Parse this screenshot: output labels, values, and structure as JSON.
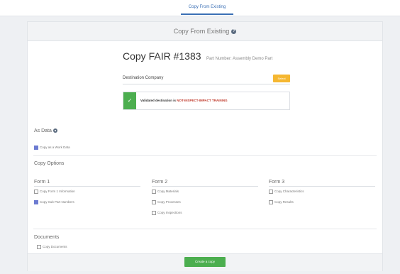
{
  "top_tab": {
    "label": "Copy From Existing"
  },
  "panel": {
    "header": "Copy From Existing",
    "title": "Copy FAIR #1383",
    "subtitle": "Part Number: Assembly Demo Part",
    "destination": {
      "label": "Destination Company",
      "button": "Select"
    },
    "alert": {
      "prefix": "Validated destination is ",
      "highlight": "NOT-INSPECT-IMPACT TRAINING"
    },
    "as_data": {
      "label": "As Data",
      "checkbox": {
        "label": "Copy as a Work Data",
        "checked": true
      }
    },
    "copy_options": {
      "label": "Copy Options",
      "columns": [
        {
          "title": "Form 1",
          "items": [
            {
              "label": "Copy Form 1 Information",
              "checked": false
            },
            {
              "label": "Copy Sub Part Numbers",
              "checked": true
            }
          ]
        },
        {
          "title": "Form 2",
          "items": [
            {
              "label": "Copy Materials",
              "checked": false
            },
            {
              "label": "Copy Processes",
              "checked": false
            },
            {
              "label": "Copy Inspections",
              "checked": false
            }
          ]
        },
        {
          "title": "Form 3",
          "items": [
            {
              "label": "Copy Characteristics",
              "checked": false
            },
            {
              "label": "Copy Results",
              "checked": false
            }
          ]
        }
      ]
    },
    "documents": {
      "label": "Documents",
      "checkbox": {
        "label": "Copy Documents",
        "checked": false
      }
    },
    "submit": "Create a copy"
  },
  "colors": {
    "accent": "#3a6fb5",
    "success": "#4cae4f",
    "warning": "#f5b731",
    "checkbox_checked": "#6c7bd1"
  }
}
